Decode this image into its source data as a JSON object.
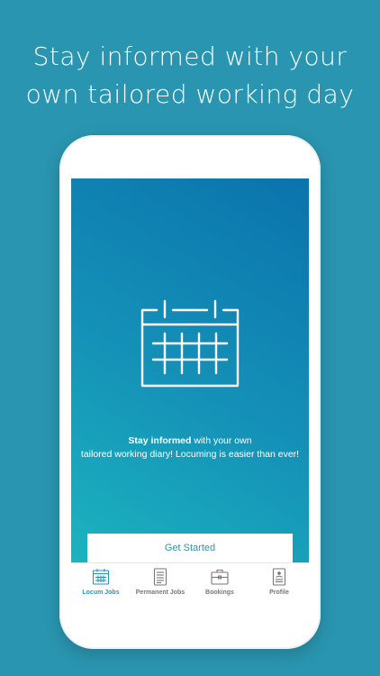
{
  "headline": {
    "line1": "Stay informed with your",
    "line2": "own tailored working day"
  },
  "onboarding": {
    "icon": "calendar-icon",
    "message_bold": "Stay informed",
    "message_rest": " with your own",
    "message_line2": "tailored working diary! Locuming is easier than ever!",
    "cta_label": "Get Started"
  },
  "tabs": [
    {
      "label": "Locum Jobs",
      "icon": "calendar-icon",
      "active": true
    },
    {
      "label": "Permanent Jobs",
      "icon": "document-icon",
      "active": false
    },
    {
      "label": "Bookings",
      "icon": "briefcase-icon",
      "active": false
    },
    {
      "label": "Profile",
      "icon": "profile-icon",
      "active": false
    }
  ],
  "colors": {
    "background": "#2a95b0",
    "gradient_start": "#1bb4bf",
    "gradient_end": "#0a73ac",
    "accent": "#2a95b0",
    "tab_inactive": "#777777"
  }
}
